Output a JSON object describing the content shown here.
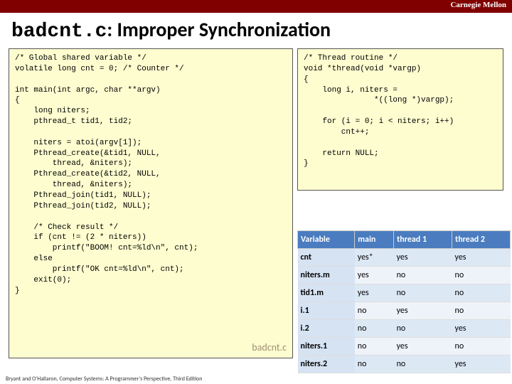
{
  "brand": "Carnegie Mellon",
  "title_code": "badcnt.c",
  "title_rest": ": Improper Synchronization",
  "left_code": "/* Global shared variable */\nvolatile long cnt = 0; /* Counter */\n\nint main(int argc, char **argv)\n{\n    long niters;\n    pthread_t tid1, tid2;\n\n    niters = atoi(argv[1]);\n    Pthread_create(&tid1, NULL,\n        thread, &niters);\n    Pthread_create(&tid2, NULL,\n        thread, &niters);\n    Pthread_join(tid1, NULL);\n    Pthread_join(tid2, NULL);\n\n    /* Check result */\n    if (cnt != (2 * niters))\n        printf(\"BOOM! cnt=%ld\\n\", cnt);\n    else\n        printf(\"OK cnt=%ld\\n\", cnt);\n    exit(0);\n}",
  "right_code": "/* Thread routine */\nvoid *thread(void *vargp)\n{\n    long i, niters =\n               *((long *)vargp);\n\n    for (i = 0; i < niters; i++)\n        cnt++;\n\n    return NULL;\n}",
  "file_tag": "badcnt.c",
  "table": {
    "headers": [
      "Variable",
      "main",
      "thread 1",
      "thread 2"
    ],
    "rows": [
      [
        "cnt",
        "yes*",
        "yes",
        "yes"
      ],
      [
        "niters.m",
        "yes",
        "no",
        "no"
      ],
      [
        "tid1.m",
        "yes",
        "no",
        "no"
      ],
      [
        "i.1",
        "no",
        "yes",
        "no"
      ],
      [
        "i.2",
        "no",
        "no",
        "yes"
      ],
      [
        "niters.1",
        "no",
        "yes",
        "no"
      ],
      [
        "niters.2",
        "no",
        "no",
        "yes"
      ]
    ]
  },
  "footer": "Bryant and O'Hallaron, Computer Systems: A Programmer's Perspective, Third Edition"
}
